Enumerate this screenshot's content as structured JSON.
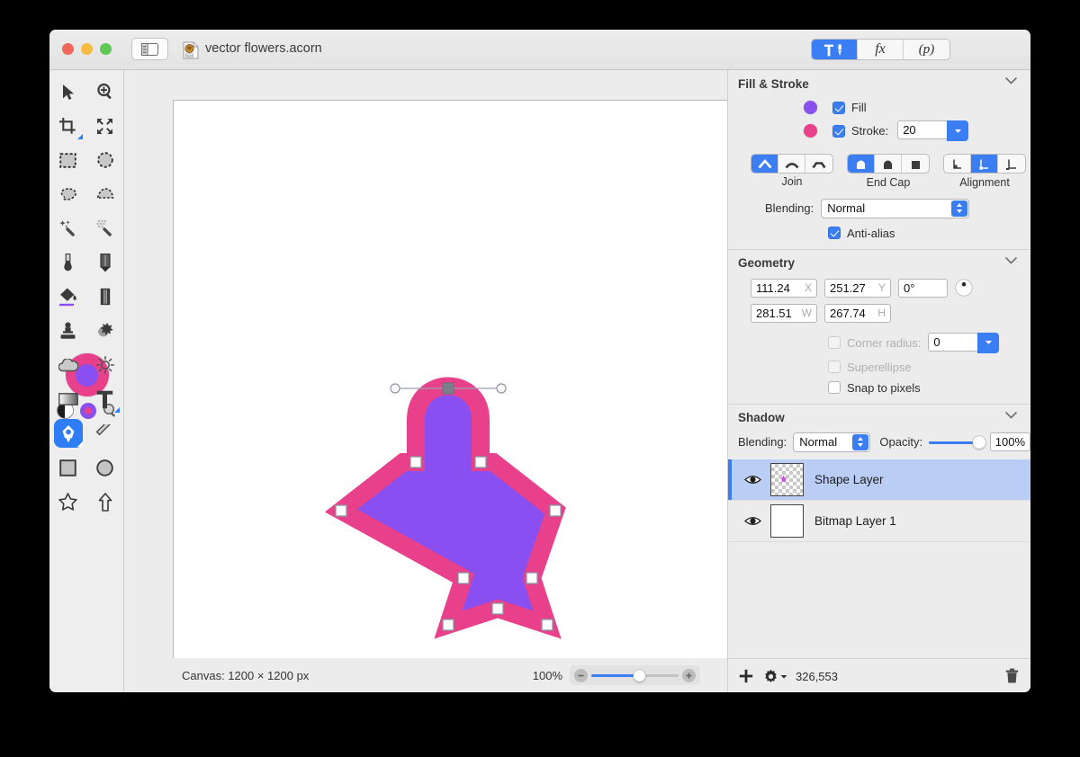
{
  "window": {
    "title": "vector flowers.acorn",
    "traffic_lights": [
      "close",
      "minimize",
      "zoom"
    ]
  },
  "toolbar": {
    "sidebar_toggle": "sidebar-toggle",
    "segments": [
      {
        "id": "tools",
        "label": "",
        "icon": "hammer-pen-icon",
        "selected": true
      },
      {
        "id": "fx",
        "label": "fx",
        "selected": false
      },
      {
        "id": "palette",
        "label": "(p)",
        "selected": false
      }
    ]
  },
  "tools": {
    "items": [
      {
        "name": "move-tool",
        "selected": false,
        "badge": false
      },
      {
        "name": "zoom-tool",
        "selected": false,
        "badge": false
      },
      {
        "name": "crop-tool",
        "selected": false,
        "badge": true
      },
      {
        "name": "transform-tool",
        "selected": false,
        "badge": false
      },
      {
        "name": "rectangle-select-tool",
        "selected": false,
        "badge": false
      },
      {
        "name": "ellipse-select-tool",
        "selected": false,
        "badge": false
      },
      {
        "name": "lasso-tool",
        "selected": false,
        "badge": false
      },
      {
        "name": "polygon-lasso-tool",
        "selected": false,
        "badge": false
      },
      {
        "name": "magic-wand-tool",
        "selected": false,
        "badge": false
      },
      {
        "name": "instant-alpha-tool",
        "selected": false,
        "badge": false
      },
      {
        "name": "brush-tool",
        "selected": false,
        "badge": false
      },
      {
        "name": "pencil-tool",
        "selected": false,
        "badge": false
      },
      {
        "name": "paint-bucket-tool",
        "selected": false,
        "badge": false
      },
      {
        "name": "eraser-tool",
        "selected": false,
        "badge": false
      },
      {
        "name": "clone-stamp-tool",
        "selected": false,
        "badge": false
      },
      {
        "name": "smudge-tool",
        "selected": false,
        "badge": false
      },
      {
        "name": "blur-tool",
        "selected": false,
        "badge": false
      },
      {
        "name": "dodge-burn-tool",
        "selected": false,
        "badge": false
      },
      {
        "name": "gradient-tool",
        "selected": false,
        "badge": false
      },
      {
        "name": "text-tool",
        "selected": false,
        "badge": true
      },
      {
        "name": "pen-tool",
        "selected": true,
        "badge": true
      },
      {
        "name": "line-tool",
        "selected": false,
        "badge": false
      },
      {
        "name": "rectangle-shape-tool",
        "selected": false,
        "badge": false
      },
      {
        "name": "ellipse-shape-tool",
        "selected": false,
        "badge": false
      },
      {
        "name": "star-shape-tool",
        "selected": false,
        "badge": false
      },
      {
        "name": "arrow-shape-tool",
        "selected": false,
        "badge": false
      }
    ],
    "swatches": {
      "stroke_color": "#e8408a",
      "fill_color": "#8a4ff0"
    }
  },
  "canvas": {
    "shape": {
      "fill_color": "#8a4ff0",
      "stroke_color": "#e8408a",
      "stroke_width": 20
    }
  },
  "statusbar": {
    "canvas_size": "Canvas: 1200 × 1200 px",
    "zoom": "100%",
    "point_count": "326,553"
  },
  "fill_stroke": {
    "title": "Fill & Stroke",
    "fill": {
      "label": "Fill",
      "checked": true,
      "color": "#8a4ff0"
    },
    "stroke": {
      "label": "Stroke:",
      "checked": true,
      "color": "#e8408a",
      "width": "20"
    },
    "join": {
      "caption": "Join",
      "options": [
        "miter-join",
        "round-join",
        "bevel-join"
      ],
      "selected_index": 0
    },
    "end_cap": {
      "caption": "End Cap",
      "options": [
        "butt-cap",
        "round-cap",
        "square-cap"
      ],
      "selected_index": 0
    },
    "alignment": {
      "caption": "Alignment",
      "options": [
        "align-inside",
        "align-center",
        "align-outside"
      ],
      "selected_index": 1
    },
    "blending": {
      "label": "Blending:",
      "value": "Normal"
    },
    "antialias": {
      "label": "Anti-alias",
      "checked": true
    }
  },
  "geometry": {
    "title": "Geometry",
    "x": {
      "value": "111.24",
      "unit": "X"
    },
    "y": {
      "value": "251.27",
      "unit": "Y"
    },
    "rotation": {
      "value": "0°"
    },
    "w": {
      "value": "281.51",
      "unit": "W"
    },
    "h": {
      "value": "267.74",
      "unit": "H"
    },
    "corner_radius": {
      "label": "Corner radius:",
      "value": "0",
      "checked": false,
      "enabled": false
    },
    "superellipse": {
      "label": "Superellipse",
      "checked": false,
      "enabled": false
    },
    "snap_to_pixels": {
      "label": "Snap to pixels",
      "checked": false,
      "enabled": true
    }
  },
  "shadow": {
    "title": "Shadow",
    "blending": {
      "label": "Blending:",
      "value": "Normal"
    },
    "opacity": {
      "label": "Opacity:",
      "value": "100%",
      "percent": 100
    }
  },
  "layers": [
    {
      "name": "Shape Layer",
      "visible": true,
      "selected": true,
      "thumb": "checker"
    },
    {
      "name": "Bitmap Layer 1",
      "visible": true,
      "selected": false,
      "thumb": "white"
    }
  ]
}
